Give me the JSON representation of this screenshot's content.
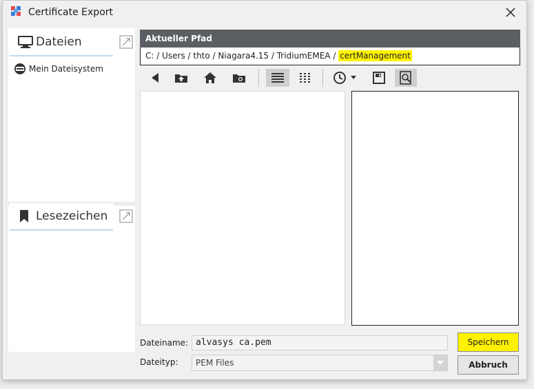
{
  "window": {
    "title": "Certificate Export",
    "close_icon": "close-icon"
  },
  "left_pane": {
    "files_tab": {
      "label": "Dateien",
      "icon": "monitor-icon"
    },
    "tree": [
      {
        "label": "Mein Dateisystem",
        "icon": "drive-icon"
      }
    ],
    "bookmarks_tab": {
      "label": "Lesezeichen",
      "icon": "bookmark-icon"
    }
  },
  "path": {
    "header": "Aktueller Pfad",
    "prefix": "C: / Users / thto / Niagara4.15 / TridiumEMEA / ",
    "current": "certManagement",
    "highlight_color": "#fff200"
  },
  "toolbar": {
    "icons": [
      "back-icon",
      "folder-up-icon",
      "home-icon",
      "new-folder-icon",
      "list-view-icon",
      "details-view-icon",
      "history-icon",
      "dropdown-icon",
      "save-bookmark-icon",
      "preview-toggle-icon"
    ]
  },
  "form": {
    "filename_label": "Dateiname:",
    "filename_value": "alvasys ca.pem",
    "filetype_label": "Dateityp:",
    "filetype_value": "PEM Files"
  },
  "buttons": {
    "save": "Speichern",
    "cancel": "Abbruch"
  },
  "colors": {
    "header_bg": "#5b5e63",
    "accent": "#fff200"
  }
}
